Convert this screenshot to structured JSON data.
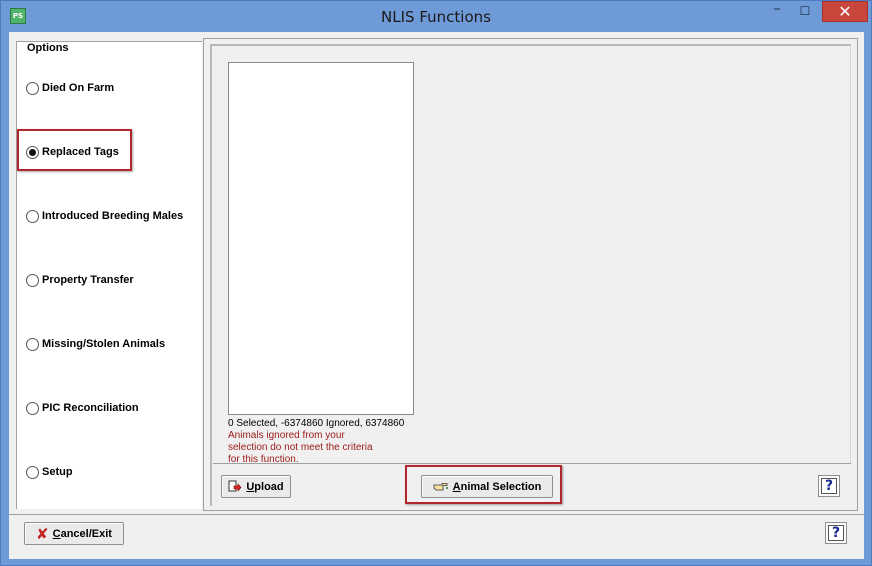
{
  "window": {
    "title": "NLIS Functions",
    "app_icon": "PS",
    "minimize": "–",
    "maximize": "☐",
    "close": "✕"
  },
  "options": {
    "legend": "Options",
    "items": [
      {
        "label": "Died On Farm",
        "checked": false
      },
      {
        "label": "Replaced Tags",
        "checked": true
      },
      {
        "label": "Introduced Breeding Males",
        "checked": false
      },
      {
        "label": "Property Transfer",
        "checked": false
      },
      {
        "label": "Missing/Stolen Animals",
        "checked": false
      },
      {
        "label": "PIC Reconciliation",
        "checked": false
      },
      {
        "label": "Setup",
        "checked": false
      }
    ]
  },
  "main": {
    "status": "0 Selected, -6374860 Ignored, 6374860",
    "message": [
      "Animals ignored from your",
      "selection do not meet the criteria",
      "for this function."
    ]
  },
  "buttons": {
    "upload_first": "U",
    "upload_rest": "pload",
    "animal_selection_first": "A",
    "animal_selection_rest": "nimal Selection",
    "cancel_first": "C",
    "cancel_rest": "ancel/Exit",
    "help": "?"
  },
  "colors": {
    "title_bar": "#6f9ad8",
    "close_button": "#c9463d",
    "highlight": "#b0262a",
    "message_text": "#9b1a1a"
  }
}
